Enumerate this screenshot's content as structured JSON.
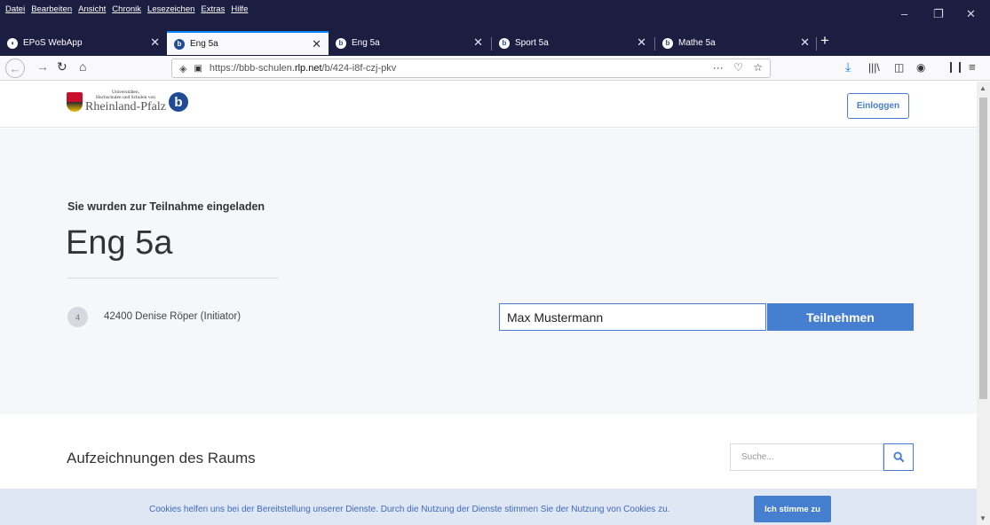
{
  "menu": [
    "Datei",
    "Bearbeiten",
    "Ansicht",
    "Chronik",
    "Lesezeichen",
    "Extras",
    "Hilfe"
  ],
  "tabs": [
    {
      "title": "EPoS WebApp",
      "icon": "epos-icon"
    },
    {
      "title": "Eng 5a",
      "icon": "bbb-icon"
    },
    {
      "title": "Eng 5a",
      "icon": "bbb-icon"
    },
    {
      "title": "Sport 5a",
      "icon": "bbb-icon"
    },
    {
      "title": "Mathe 5a",
      "icon": "bbb-icon"
    }
  ],
  "active_tab": 1,
  "url": {
    "prefix": "https://bbb-schulen.",
    "domain": "rlp.net",
    "path": "/b/424-i8f-czj-pkv",
    "more": "···"
  },
  "logo": {
    "line1": "Universitäten,",
    "line2": "Hochschulen und Schulen von",
    "line3": "Rheinland-Pfalz",
    "bbb_letter": "b"
  },
  "header": {
    "login_label": "Einloggen"
  },
  "hero": {
    "invite_text": "Sie wurden zur Teilnahme eingeladen",
    "room_name": "Eng 5a",
    "owner_badge": "4",
    "owner_name": "42400 Denise Röper (Initiator)",
    "name_value": "Max Mustermann",
    "join_label": "Teilnehmen"
  },
  "recordings": {
    "title": "Aufzeichnungen des Raums",
    "search_placeholder": "Suche..."
  },
  "cookies": {
    "text": "Cookies helfen uns bei der Bereitstellung unserer Dienste. Durch die Nutzung der Dienste stimmen Sie der Nutzung von Cookies zu.",
    "accept_label": "Ich stimme zu"
  },
  "colors": {
    "titlebar": "#1b1d41",
    "accent": "#467fcf",
    "hero_bg": "#f5f7fb",
    "cookie_bg": "#dfe6f4"
  }
}
